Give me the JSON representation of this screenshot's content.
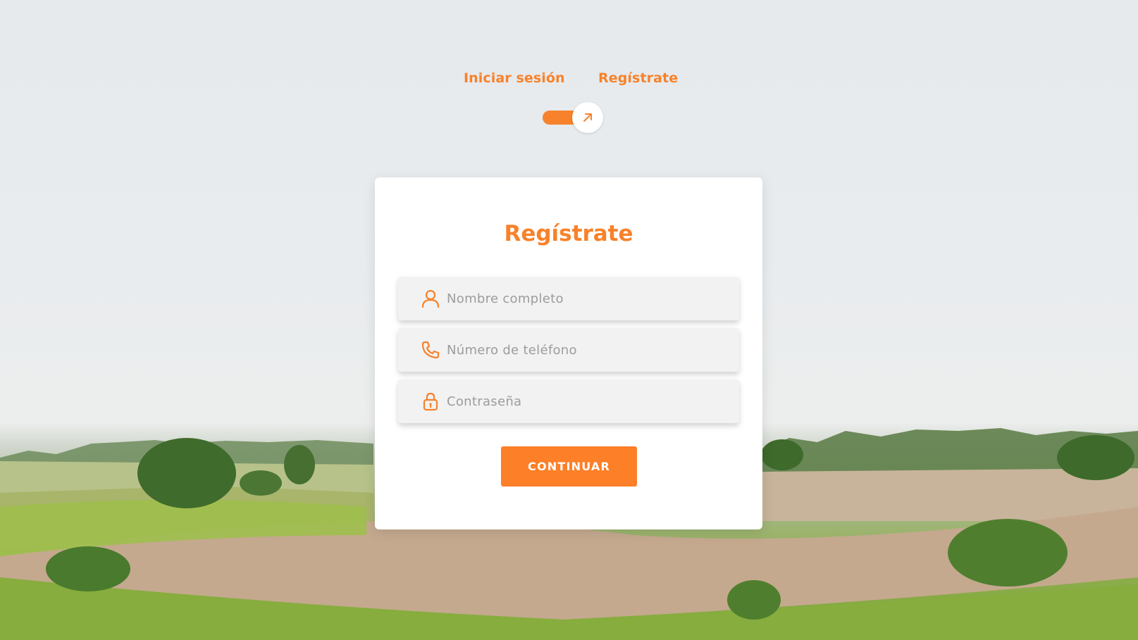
{
  "switcher": {
    "login_label": "Iniciar sesión",
    "register_label": "Regístrate"
  },
  "form": {
    "title": "Regístrate",
    "fields": [
      {
        "placeholder": "Nombre completo",
        "icon": "user-icon"
      },
      {
        "placeholder": "Número de teléfono",
        "icon": "phone-icon"
      },
      {
        "placeholder": "Contraseña",
        "icon": "lock-icon"
      }
    ],
    "submit_label": "CONTINUAR"
  },
  "colors": {
    "accent": "#f7822b",
    "button": "#fd7f27",
    "field_bg": "#f2f2f2",
    "card_bg": "#ffffff"
  }
}
